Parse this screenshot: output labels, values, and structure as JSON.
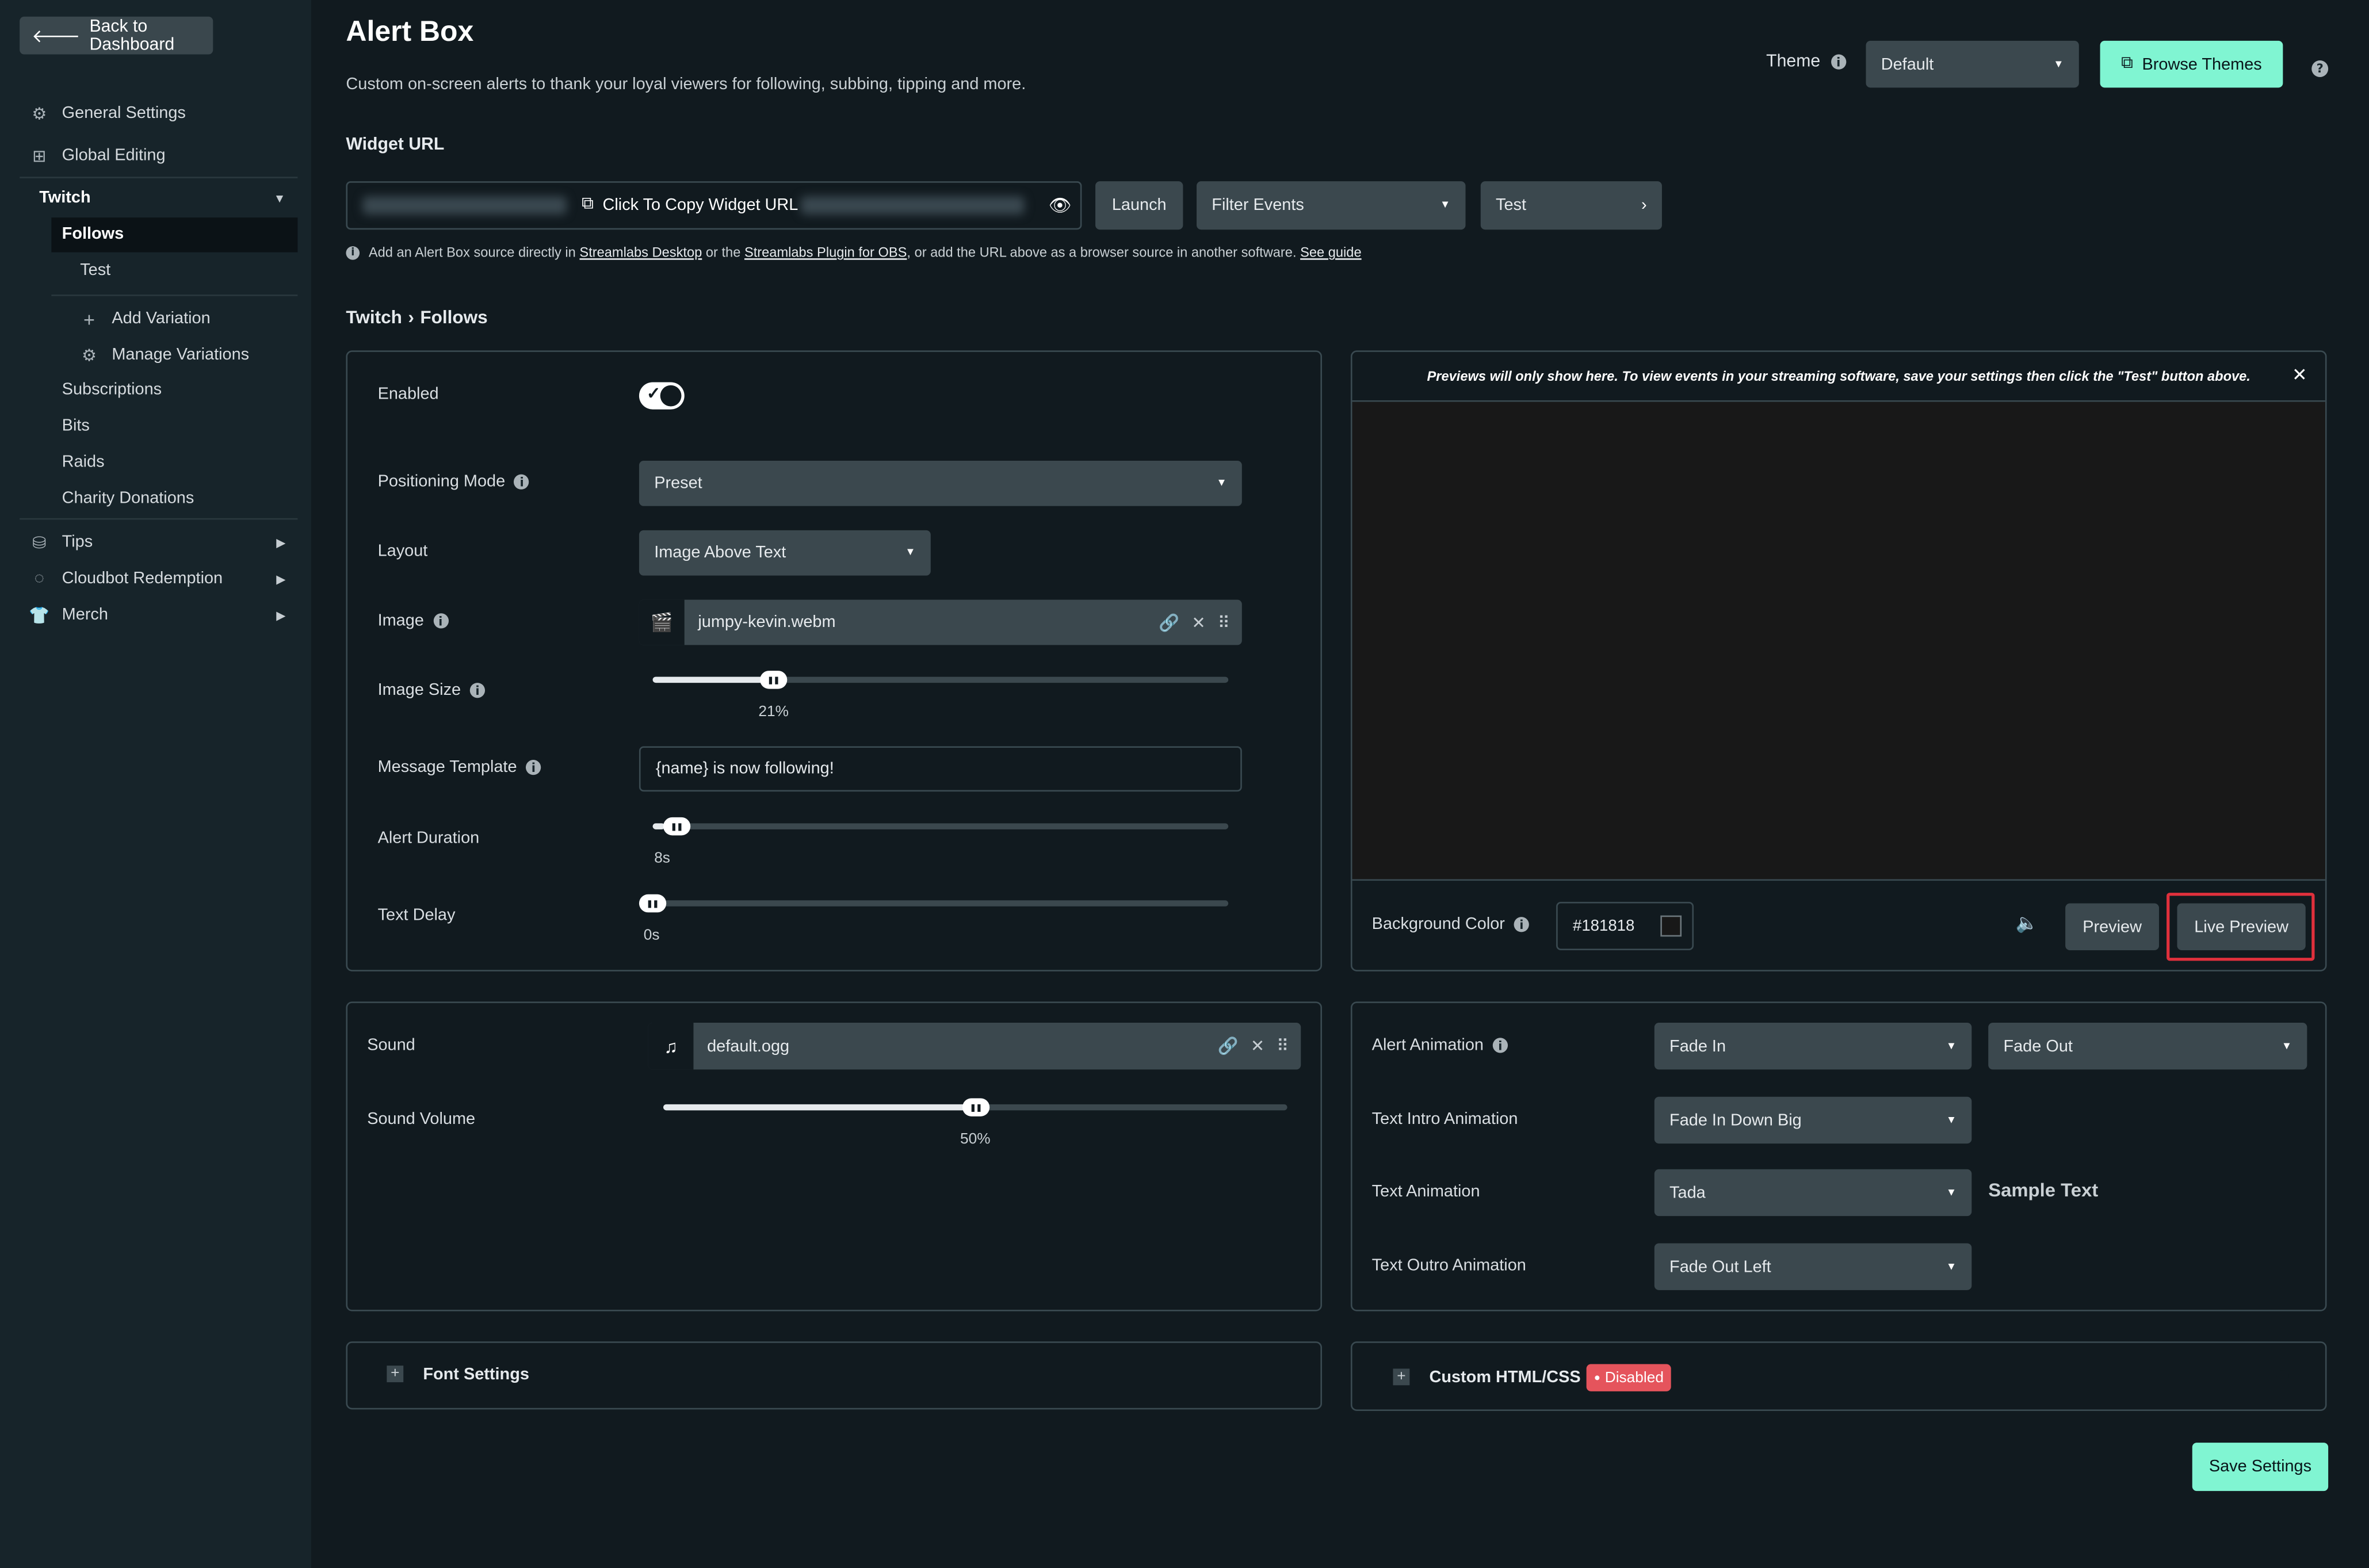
{
  "sidebar": {
    "back_label": "Back to Dashboard",
    "items": {
      "general_settings": "General Settings",
      "global_editing": "Global Editing",
      "twitch": "Twitch",
      "follows": "Follows",
      "test": "Test",
      "add_variation": "Add Variation",
      "manage_variations": "Manage Variations",
      "subscriptions": "Subscriptions",
      "bits": "Bits",
      "raids": "Raids",
      "charity_donations": "Charity Donations",
      "tips": "Tips",
      "cloudbot_redemption": "Cloudbot Redemption",
      "merch": "Merch"
    }
  },
  "header": {
    "title": "Alert Box",
    "subtitle": "Custom on-screen alerts to thank your loyal viewers for following, subbing, tipping and more.",
    "theme_label": "Theme",
    "theme_value": "Default",
    "browse_themes": "Browse Themes"
  },
  "widget": {
    "section_label": "Widget URL",
    "copy_label": "Click To Copy Widget URL",
    "launch": "Launch",
    "filter_events": "Filter Events",
    "test": "Test",
    "hint_prefix": "Add an Alert Box source directly in",
    "hint_link1": "Streamlabs Desktop",
    "hint_mid": "or the",
    "hint_link2": "Streamlabs Plugin for OBS",
    "hint_suffix": ", or add the URL above as a browser source in another software.",
    "hint_link3": "See guide"
  },
  "breadcrumb": {
    "parent": "Twitch",
    "separator": "›",
    "current": "Follows"
  },
  "settings": {
    "enabled_label": "Enabled",
    "enabled": true,
    "positioning_label": "Positioning Mode",
    "positioning_value": "Preset",
    "layout_label": "Layout",
    "layout_value": "Image Above Text",
    "image_label": "Image",
    "image_file": "jumpy-kevin.webm",
    "image_size_label": "Image Size",
    "image_size_value": "21%",
    "image_size_fraction": 0.21,
    "message_label": "Message Template",
    "message_value": "{name} is now following!",
    "duration_label": "Alert Duration",
    "duration_value": "8s",
    "duration_fraction": 0.02,
    "text_delay_label": "Text Delay",
    "text_delay_value": "0s",
    "text_delay_fraction": 0.0
  },
  "preview": {
    "notice": "Previews will only show here. To view events in your streaming software, save your settings then click the \"Test\" button above.",
    "bg_label": "Background Color",
    "bg_value": "#181818",
    "bg_color": "#181818",
    "preview_btn": "Preview",
    "live_preview_btn": "Live Preview"
  },
  "sound": {
    "label": "Sound",
    "file": "default.ogg",
    "volume_label": "Sound Volume",
    "volume_value": "50%",
    "volume_fraction": 0.5
  },
  "animation": {
    "alert_label": "Alert Animation",
    "alert_in": "Fade In",
    "alert_out": "Fade Out",
    "text_intro_label": "Text Intro Animation",
    "text_intro_value": "Fade In Down Big",
    "text_anim_label": "Text Animation",
    "text_anim_value": "Tada",
    "sample_text": "Sample Text",
    "text_outro_label": "Text Outro Animation",
    "text_outro_value": "Fade Out Left"
  },
  "font_settings": {
    "label": "Font Settings"
  },
  "custom_html": {
    "label": "Custom HTML/CSS",
    "status": "Disabled"
  },
  "save_label": "Save Settings",
  "colors": {
    "accent": "#80f5d2",
    "highlight_border": "#e0303c",
    "disabled_badge": "#e5545c"
  }
}
